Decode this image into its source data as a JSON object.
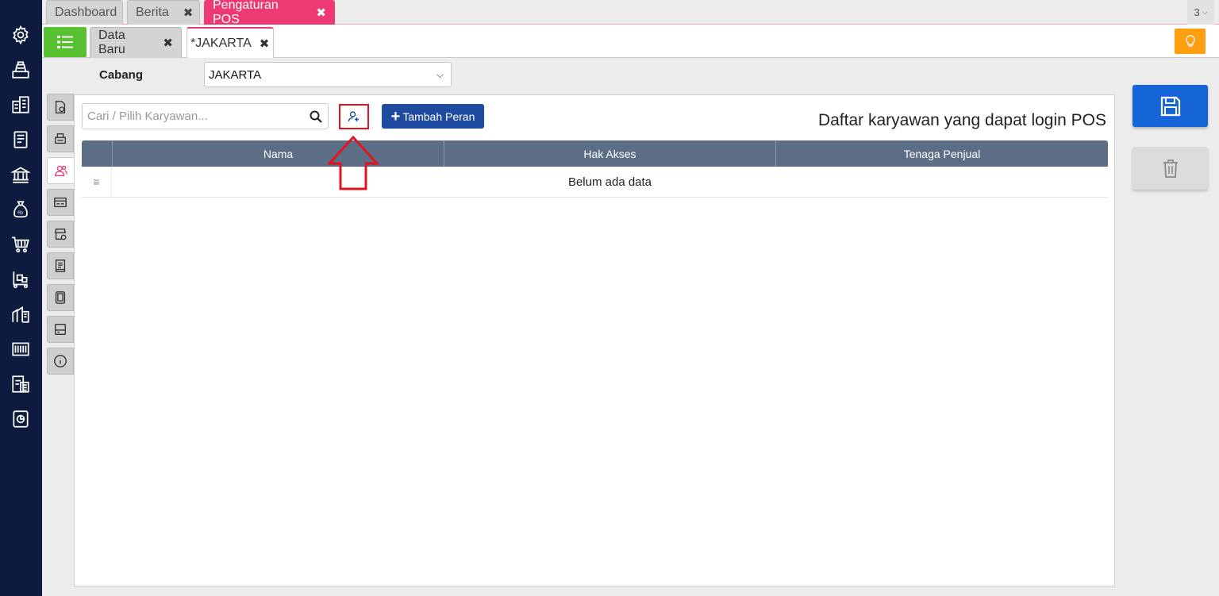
{
  "top_tabs": [
    {
      "label": "Dashboard",
      "closable": false
    },
    {
      "label": "Berita",
      "closable": true
    },
    {
      "label": "Pengaturan POS",
      "closable": true,
      "active": true
    }
  ],
  "tab_count": "3",
  "sub_tabs": [
    {
      "label": "Data Baru",
      "closable": true
    },
    {
      "label": "*JAKARTA",
      "closable": true,
      "active": true
    }
  ],
  "branch": {
    "label": "Cabang",
    "value": "JAKARTA"
  },
  "search": {
    "placeholder": "Cari / Pilih Karyawan..."
  },
  "toolbar": {
    "add_role_label": "Tambah Peran"
  },
  "panel_title": "Daftar karyawan yang dapat login POS",
  "table": {
    "columns": [
      "Nama",
      "Hak Akses",
      "Tenaga Penjual"
    ],
    "empty_text": "Belum ada data"
  },
  "left_nav_icons": [
    "settings-icon",
    "cash-register-icon",
    "building-icon",
    "book-icon",
    "bank-icon",
    "money-bag-icon",
    "cart-icon",
    "trolley-icon",
    "warehouse-icon",
    "barcode-icon",
    "tax-icon",
    "report-icon"
  ],
  "side_tab_icons": [
    "document-settings-icon",
    "printer-icon",
    "users-icon",
    "receipt-icon",
    "store-settings-icon",
    "invoice-icon",
    "tablet-icon",
    "card-icon",
    "info-icon"
  ],
  "colors": {
    "nav_bg": "#0d1b3e",
    "accent_pink": "#ee3a72",
    "menu_green": "#58c132",
    "primary_blue": "#1565d8",
    "add_role_blue": "#1e4ba0",
    "grid_header": "#5c6e86",
    "bulb_orange": "#ff9e0f",
    "highlight_red": "#e0141e"
  }
}
